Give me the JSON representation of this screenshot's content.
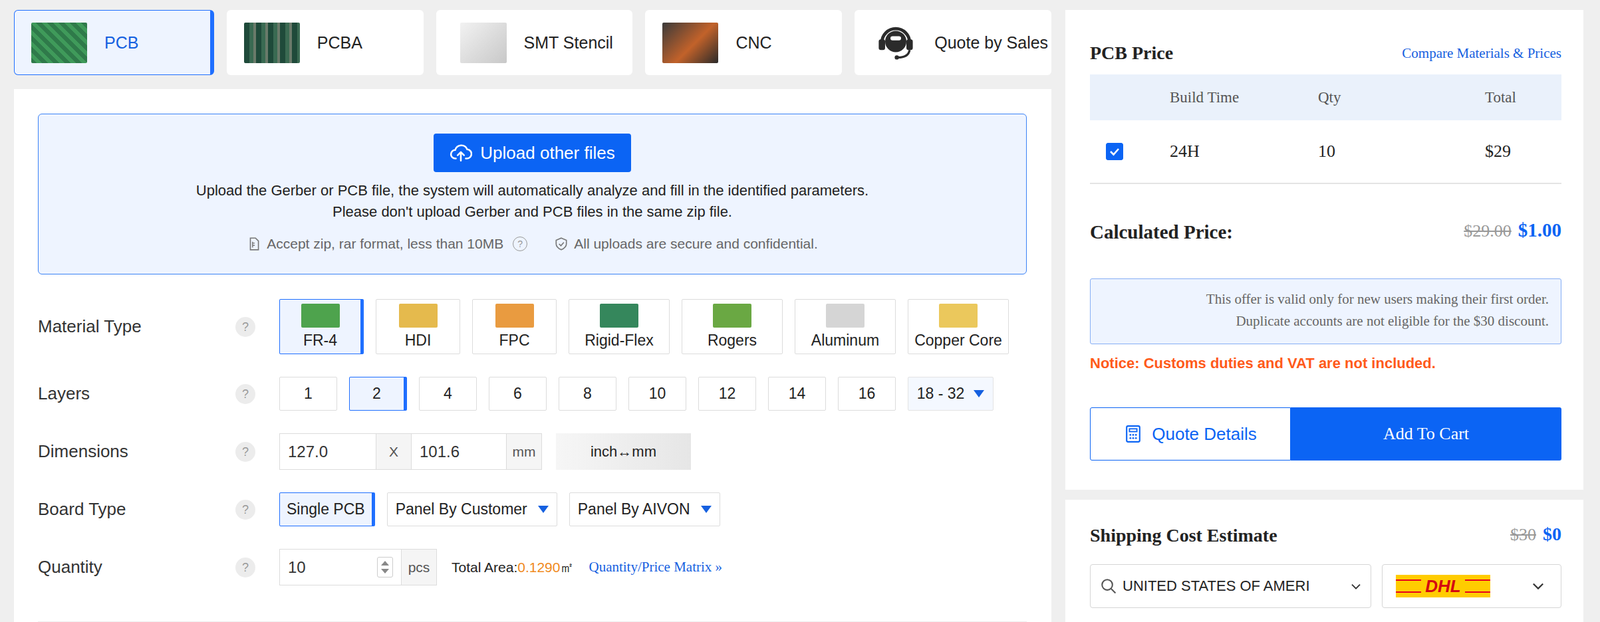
{
  "tabs": [
    {
      "label": "PCB",
      "selected": true,
      "kind": "photo"
    },
    {
      "label": "PCBA",
      "selected": false,
      "kind": "photo"
    },
    {
      "label": "SMT Stencil",
      "selected": false,
      "kind": "photo"
    },
    {
      "label": "CNC",
      "selected": false,
      "kind": "photo"
    },
    {
      "label": "Quote by Sales",
      "selected": false,
      "kind": "icon"
    }
  ],
  "upload": {
    "button": "Upload other files",
    "description": [
      "Upload the Gerber or PCB file, the system will automatically analyze and fill in the identified parameters.",
      "Please don't upload Gerber and PCB files in the same zip file."
    ],
    "notes": [
      {
        "text": "Accept zip, rar format, less than 10MB",
        "help": "?"
      },
      {
        "text": "All uploads are secure and confidential.",
        "help": ""
      }
    ]
  },
  "form": {
    "material_type": {
      "label": "Material Type",
      "help": "?",
      "options": [
        {
          "label": "FR-4",
          "selected": true,
          "color": "#3c9a3a"
        },
        {
          "label": "HDI",
          "selected": false,
          "color": "#e2b23a"
        },
        {
          "label": "FPC",
          "selected": false,
          "color": "#e7902b"
        },
        {
          "label": "Rigid-Flex",
          "selected": false,
          "color": "#1f7a4a"
        },
        {
          "label": "Rogers",
          "selected": false,
          "color": "#5a9e2f"
        },
        {
          "label": "Aluminum",
          "selected": false,
          "color": "#d0d0d0"
        },
        {
          "label": "Copper Core",
          "selected": false,
          "color": "#e9c24a"
        }
      ]
    },
    "layers": {
      "label": "Layers",
      "help": "?",
      "options": [
        {
          "label": "1",
          "selected": false,
          "kind": "button"
        },
        {
          "label": "2",
          "selected": true,
          "kind": "button"
        },
        {
          "label": "4",
          "selected": false,
          "kind": "button"
        },
        {
          "label": "6",
          "selected": false,
          "kind": "button"
        },
        {
          "label": "8",
          "selected": false,
          "kind": "button"
        },
        {
          "label": "10",
          "selected": false,
          "kind": "button"
        },
        {
          "label": "12",
          "selected": false,
          "kind": "button"
        },
        {
          "label": "14",
          "selected": false,
          "kind": "button"
        },
        {
          "label": "16",
          "selected": false,
          "kind": "button"
        },
        {
          "label": "18 - 32",
          "selected": false,
          "kind": "dropdown"
        }
      ]
    },
    "dimensions": {
      "label": "Dimensions",
      "help": "?",
      "width": "127.0",
      "separator": "X",
      "height": "101.6",
      "unit": "mm",
      "toggle": "inch↔mm"
    },
    "board_type": {
      "label": "Board Type",
      "help": "?",
      "options": [
        {
          "label": "Single PCB",
          "selected": true,
          "kind": "button"
        },
        {
          "label": "Panel By Customer",
          "selected": false,
          "kind": "dropdown"
        },
        {
          "label": "Panel By AIVON",
          "selected": false,
          "kind": "dropdown"
        }
      ]
    },
    "quantity": {
      "label": "Quantity",
      "help": "?",
      "value": "10",
      "unit": "pcs",
      "area_label": "Total Area:",
      "area_value": "0.1290",
      "area_unit": "㎡",
      "matrix_link": "Quantity/Price Matrix »"
    }
  },
  "price": {
    "title": "PCB Price",
    "compare_link": "Compare Materials & Prices",
    "columns": [
      "Build Time",
      "Qty",
      "Total"
    ],
    "rows": [
      {
        "checked": true,
        "build_time": "24H",
        "qty": "10",
        "total": "$29"
      }
    ],
    "calculated_label": "Calculated Price:",
    "original_price": "$29.00",
    "price": "$1.00",
    "offer": [
      "This offer is valid only for new users making their first order.",
      "Duplicate accounts are not eligible for the $30 discount."
    ],
    "notice": "Notice: Customs duties and VAT are not included.",
    "details_button": "Quote Details",
    "cart_button": "Add To Cart"
  },
  "shipping": {
    "title": "Shipping Cost Estimate",
    "original_price": "$30",
    "price": "$0",
    "country": "UNITED STATES OF AMERI",
    "carrier": "DHL"
  }
}
